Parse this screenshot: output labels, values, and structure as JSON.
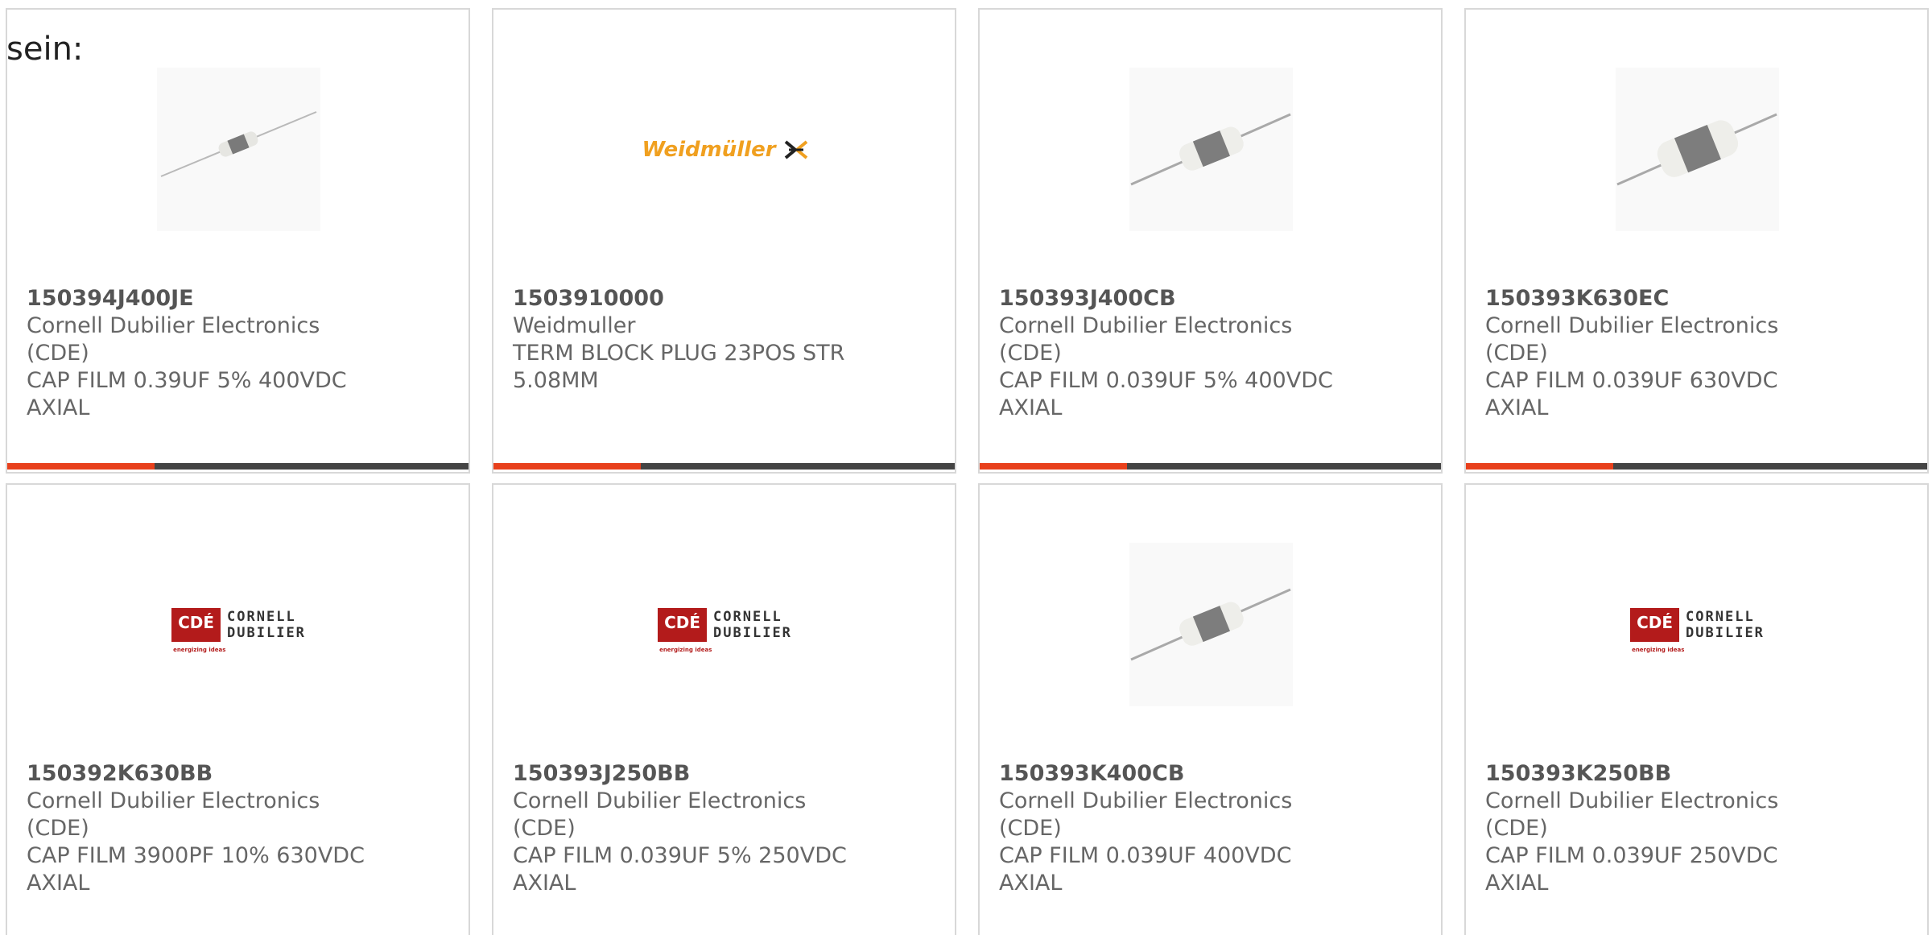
{
  "intro_text": "sein:",
  "products": [
    {
      "part_number": "150394J400JE",
      "manufacturer": "Cornell Dubilier Electronics (CDE)",
      "desc_line1": "CAP FILM 0.39UF 5% 400VDC",
      "desc_line2": "AXIAL",
      "image": "small-axial-capacitor-image"
    },
    {
      "part_number": "1503910000",
      "manufacturer": "Weidmuller",
      "desc_line1": "TERM BLOCK PLUG 23POS STR",
      "desc_line2": "5.08MM",
      "image": "weidmuller-logo",
      "logo_text": "Weidmüller"
    },
    {
      "part_number": "150393J400CB",
      "manufacturer": "Cornell Dubilier Electronics (CDE)",
      "desc_line1": "CAP FILM 0.039UF 5% 400VDC",
      "desc_line2": "AXIAL",
      "image": "axial-capacitor-image"
    },
    {
      "part_number": "150393K630EC",
      "manufacturer": "Cornell Dubilier Electronics (CDE)",
      "desc_line1": "CAP FILM 0.039UF 630VDC AXIAL",
      "desc_line2": "",
      "image": "large-axial-capacitor-image"
    },
    {
      "part_number": "150392K630BB",
      "manufacturer": "Cornell Dubilier Electronics (CDE)",
      "desc_line1": "CAP FILM 3900PF 10% 630VDC",
      "desc_line2": "AXIAL",
      "image": "cde-logo"
    },
    {
      "part_number": "150393J250BB",
      "manufacturer": "Cornell Dubilier Electronics (CDE)",
      "desc_line1": "CAP FILM 0.039UF 5% 250VDC",
      "desc_line2": "AXIAL",
      "image": "cde-logo"
    },
    {
      "part_number": "150393K400CB",
      "manufacturer": "Cornell Dubilier Electronics (CDE)",
      "desc_line1": "CAP FILM 0.039UF 400VDC AXIAL",
      "desc_line2": "",
      "image": "axial-capacitor-image"
    },
    {
      "part_number": "150393K250BB",
      "manufacturer": "Cornell Dubilier Electronics (CDE)",
      "desc_line1": "CAP FILM 0.039UF 250VDC AXIAL",
      "desc_line2": "",
      "image": "cde-logo"
    }
  ],
  "cde_logo": {
    "box_text": "CDÉ",
    "word1": "CORNELL",
    "word2": "DUBILIER",
    "tagline": "energizing ideas"
  },
  "colors": {
    "accent_bar": "#e8401c",
    "bar_base": "#444444",
    "cde_red": "#b31b1b",
    "weidmuller_orange": "#f0a020"
  }
}
